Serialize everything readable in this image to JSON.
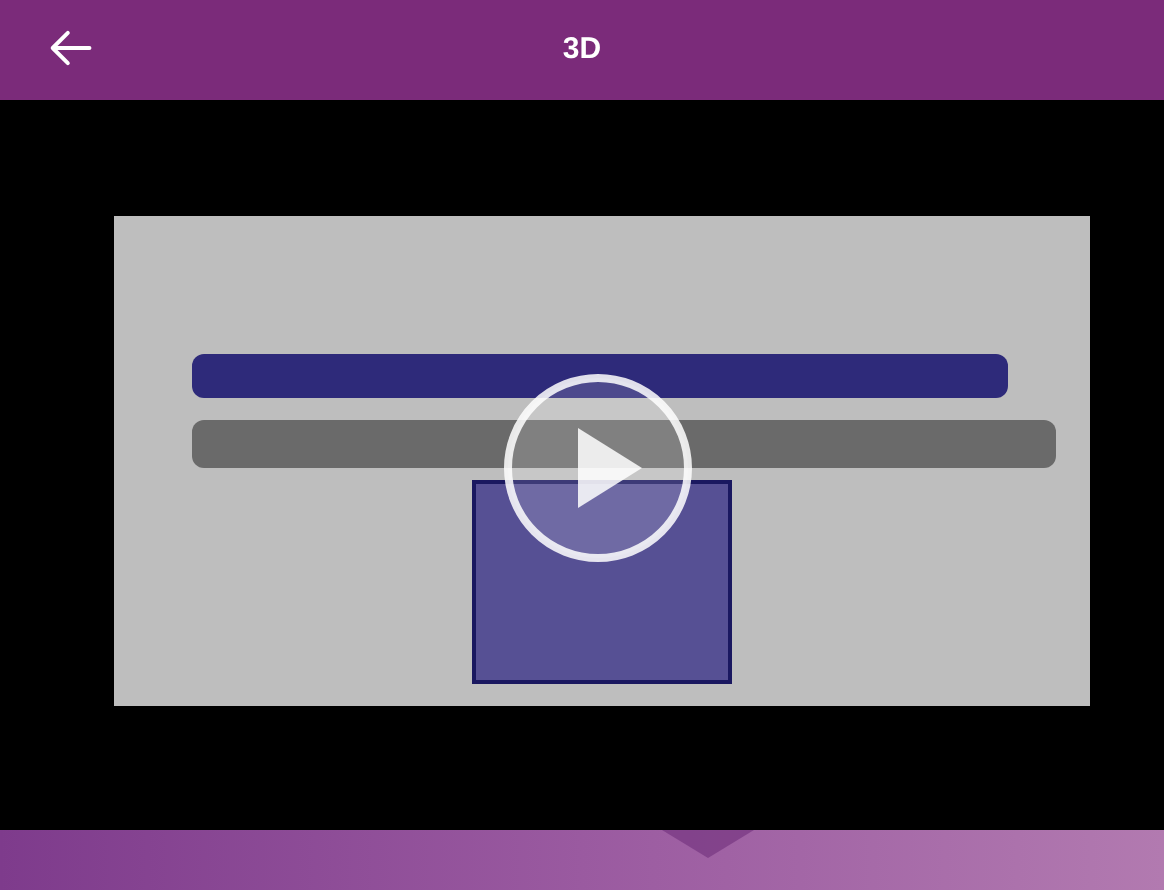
{
  "header": {
    "title": "3D"
  }
}
